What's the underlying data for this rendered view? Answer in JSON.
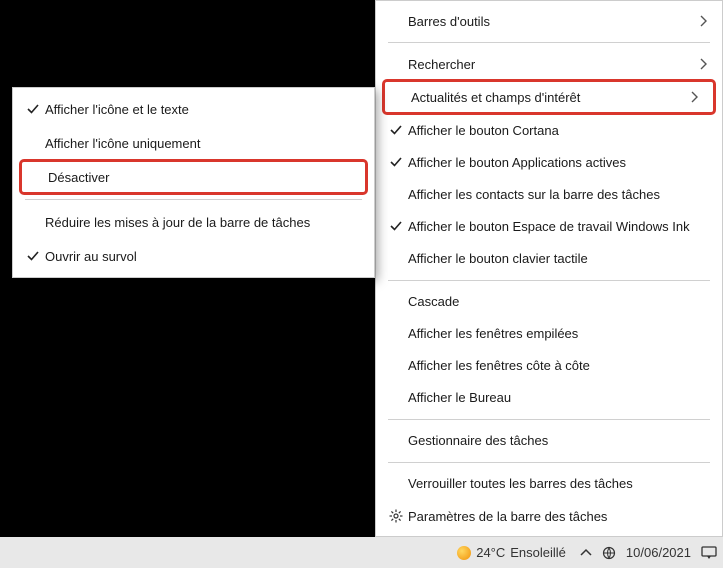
{
  "right_menu": {
    "groups": [
      [
        {
          "label": "Barres d'outils",
          "arrow": true
        }
      ],
      [
        {
          "label": "Rechercher",
          "arrow": true
        },
        {
          "label": "Actualités et champs d'intérêt",
          "arrow": true,
          "highlight": true
        },
        {
          "label": "Afficher le bouton Cortana",
          "check": true
        },
        {
          "label": "Afficher le bouton Applications actives",
          "check": true
        },
        {
          "label": "Afficher les contacts sur la barre des tâches"
        },
        {
          "label": "Afficher le bouton Espace de travail Windows Ink",
          "check": true
        },
        {
          "label": "Afficher le bouton clavier tactile"
        }
      ],
      [
        {
          "label": "Cascade"
        },
        {
          "label": "Afficher les fenêtres empilées"
        },
        {
          "label": "Afficher les fenêtres côte à côte"
        },
        {
          "label": "Afficher le Bureau"
        }
      ],
      [
        {
          "label": "Gestionnaire des tâches"
        }
      ],
      [
        {
          "label": "Verrouiller toutes les barres des tâches"
        },
        {
          "label": "Paramètres de la barre des tâches",
          "gear": true
        }
      ]
    ]
  },
  "left_menu": {
    "groups": [
      [
        {
          "label": "Afficher l'icône et le texte",
          "check": true
        },
        {
          "label": "Afficher l'icône uniquement"
        },
        {
          "label": "Désactiver",
          "highlight": true
        }
      ],
      [
        {
          "label": "Réduire les mises à jour de la barre de tâches"
        },
        {
          "label": "Ouvrir au survol",
          "check": true
        }
      ]
    ]
  },
  "taskbar": {
    "weather_temp": "24°C",
    "weather_desc": "Ensoleillé",
    "date": "10/06/2021"
  }
}
